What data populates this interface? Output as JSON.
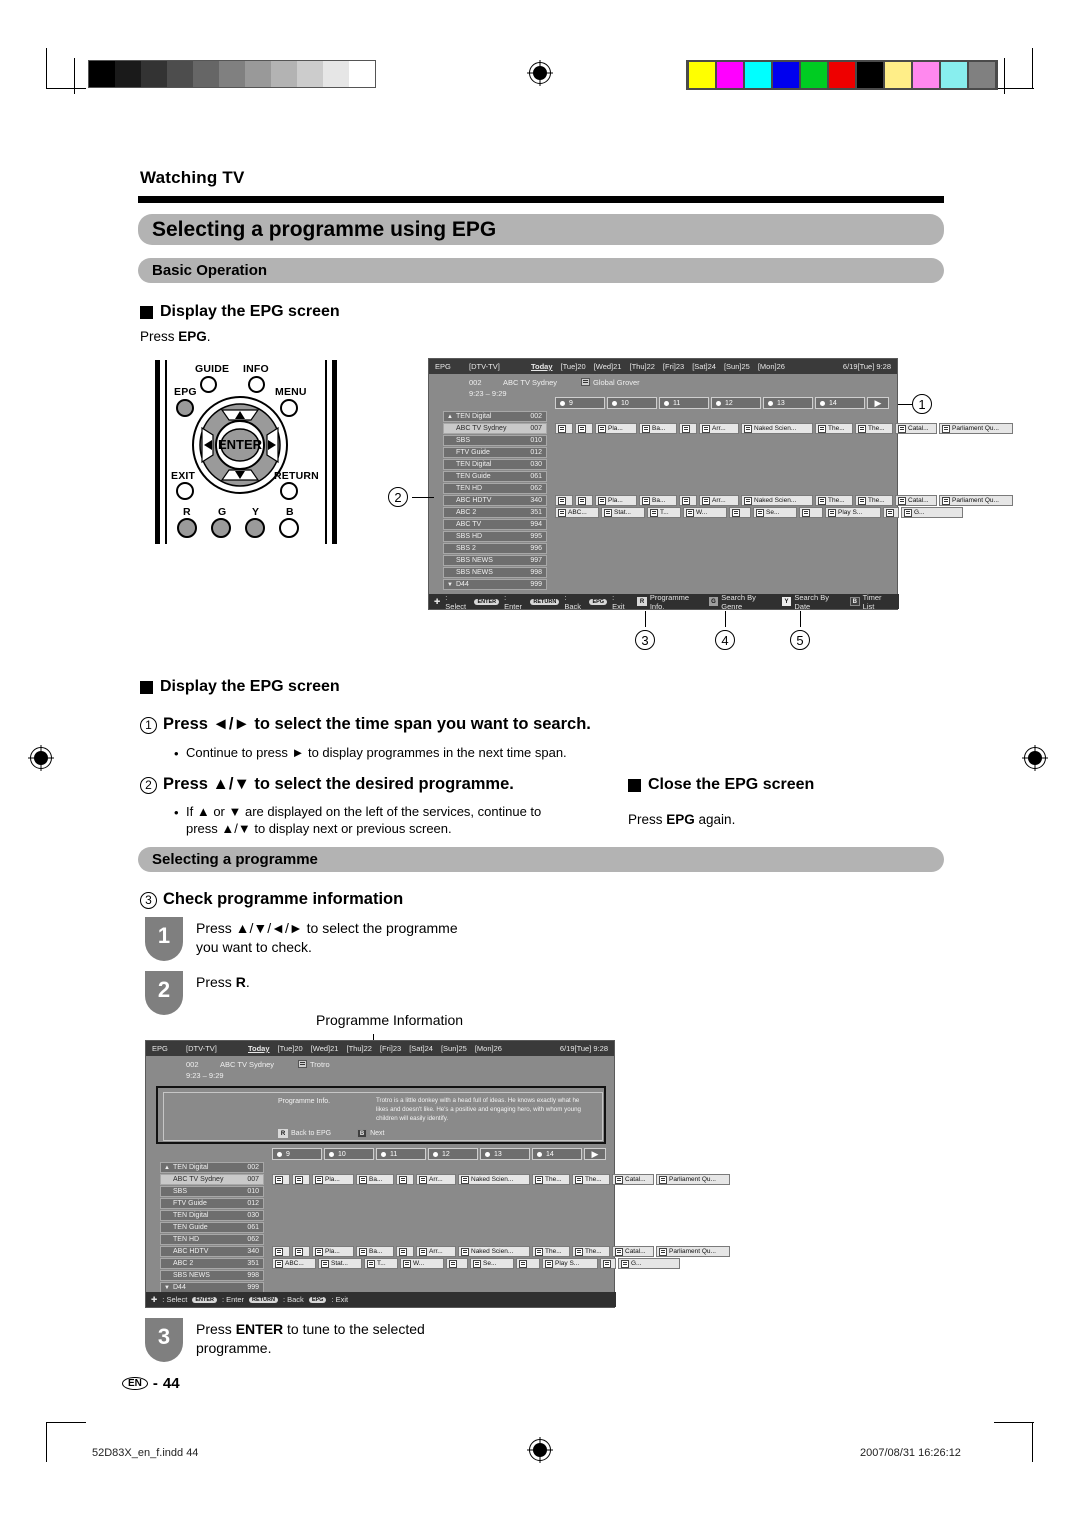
{
  "document": {
    "breadcrumb": "Watching TV",
    "title": "Selecting a programme using EPG",
    "section_basic": "Basic Operation",
    "section_selecting": "Selecting a programme",
    "page_label": "EN",
    "page_separator": "-",
    "page_number": "44"
  },
  "footer": {
    "file": "52D83X_en_f.indd  44",
    "timestamp": "2007/08/31   16:26:12"
  },
  "display_section": {
    "heading": "Display the EPG screen",
    "press_prefix": "Press ",
    "press_key": "EPG",
    "press_suffix": "."
  },
  "remote": {
    "labels": {
      "guide": "GUIDE",
      "info": "INFO",
      "epg": "EPG",
      "menu": "MENU",
      "enter": "ENTER",
      "exit": "EXIT",
      "return": "RETURN",
      "r": "R",
      "g": "G",
      "y": "Y",
      "b": "B"
    }
  },
  "callouts": {
    "one": "1",
    "two": "2",
    "three": "3",
    "four": "4",
    "five": "5"
  },
  "instructions": {
    "heading2": "Display the EPG screen",
    "step1": {
      "num": "1",
      "text": "Press ◄/► to select the time span you want to search.",
      "bullet": "Continue to press ► to display programmes in the next time span."
    },
    "step2": {
      "num": "2",
      "text": "Press ▲/▼ to select the desired programme.",
      "bullet_line1": "If ▲ or ▼ are displayed on the left of the services, continue to",
      "bullet_line2": "press ▲/▼ to display next or previous screen."
    },
    "close": {
      "heading": "Close the EPG screen",
      "text_prefix": "Press ",
      "text_key": "EPG",
      "text_suffix": " again."
    },
    "step3": {
      "num": "3",
      "heading": "Check programme information",
      "sub1": {
        "badge": "1",
        "line1": "Press ▲/▼/◄/► to select the programme",
        "line2": "you want to check."
      },
      "sub2": {
        "badge": "2",
        "text_prefix": "Press ",
        "text_key": "R",
        "text_suffix": "."
      },
      "sub3": {
        "badge": "3",
        "line1_prefix": "Press ",
        "line1_key": "ENTER",
        "line1_suffix": " to tune to the selected",
        "line2": "programme."
      }
    }
  },
  "caption": {
    "programme_information": "Programme Information"
  },
  "epg": {
    "header": {
      "app": "EPG",
      "source": "[DTV-TV]",
      "days": [
        "Today",
        "[Tue]20",
        "[Wed]21",
        "[Thu]22",
        "[Fri]23",
        "[Sat]24",
        "[Sun]25",
        "[Mon]26"
      ],
      "clock": "6/19[Tue]  9:28"
    },
    "now": {
      "channel_number": "002",
      "channel_name": "ABC TV Sydney",
      "programme_title": "Global Grover",
      "time_range": "9:23 – 9:29"
    },
    "timeslots": [
      "9",
      "10",
      "11",
      "12",
      "13",
      "14"
    ],
    "channels": [
      {
        "name": "TEN Digital",
        "number": "002",
        "arrow": "▲",
        "selected": false
      },
      {
        "name": "ABC TV Sydney",
        "number": "007",
        "arrow": "",
        "selected": true
      },
      {
        "name": "SBS",
        "number": "010",
        "arrow": "",
        "selected": false
      },
      {
        "name": "FTV Guide",
        "number": "012",
        "arrow": "",
        "selected": false
      },
      {
        "name": "TEN Digital",
        "number": "030",
        "arrow": "",
        "selected": false
      },
      {
        "name": "TEN Guide",
        "number": "061",
        "arrow": "",
        "selected": false
      },
      {
        "name": "TEN HD",
        "number": "062",
        "arrow": "",
        "selected": false
      },
      {
        "name": "ABC HDTV",
        "number": "340",
        "arrow": "",
        "selected": false
      },
      {
        "name": "ABC 2",
        "number": "351",
        "arrow": "",
        "selected": false
      },
      {
        "name": "ABC TV",
        "number": "994",
        "arrow": "",
        "selected": false
      },
      {
        "name": "SBS HD",
        "number": "995",
        "arrow": "",
        "selected": false
      },
      {
        "name": "SBS 2",
        "number": "996",
        "arrow": "",
        "selected": false
      },
      {
        "name": "SBS NEWS",
        "number": "997",
        "arrow": "",
        "selected": false
      },
      {
        "name": "SBS NEWS",
        "number": "998",
        "arrow": "",
        "selected": false
      },
      {
        "name": "D44",
        "number": "999",
        "arrow": "▼",
        "selected": false
      }
    ],
    "programme_row_a": [
      "Pla...",
      "Ba...",
      "Arr...",
      "Naked Scien...",
      "The...",
      "The...",
      "Catal...",
      "Parliament Qu..."
    ],
    "programme_row_b": [
      "ABC...",
      "Stat...",
      "T...",
      "W...",
      "Se...",
      "Play S...",
      "G..."
    ],
    "bar": {
      "select": ": Select",
      "enter_key": "ENTER",
      "enter": ": Enter",
      "return_key": "RETURN",
      "back": ": Back",
      "epg_key": "EPG",
      "exit": ": Exit",
      "buttons": [
        {
          "key": "R",
          "label": "Programme Info."
        },
        {
          "key": "G",
          "label": "Search By Genre"
        },
        {
          "key": "Y",
          "label": "Search By Date"
        },
        {
          "key": "B",
          "label": "Timer List"
        }
      ]
    }
  },
  "epg2": {
    "header": {
      "app": "EPG",
      "source": "[DTV-TV]",
      "days": [
        "Today",
        "[Tue]20",
        "[Wed]21",
        "[Thu]22",
        "[Fri]23",
        "[Sat]24",
        "[Sun]25",
        "[Mon]26"
      ],
      "clock": "6/19[Tue]  9:28"
    },
    "now": {
      "channel_number": "002",
      "channel_name": "ABC TV Sydney",
      "programme_title": "Trotro",
      "time_range": "9:23 – 9:29"
    },
    "info_panel": {
      "label": "Programme Info.",
      "text": "Trotro is a little donkey with a head full of ideas. He knows exactly what he likes and doesn't like. He's a positive and engaging hero, with whom young children will easily identify.",
      "key_back": "R",
      "label_back": "Back to EPG",
      "key_next": "B",
      "label_next": "Next"
    },
    "timeslots": [
      "9",
      "10",
      "11",
      "12",
      "13",
      "14"
    ],
    "channels": [
      {
        "name": "TEN Digital",
        "number": "002",
        "arrow": "▲",
        "selected": false
      },
      {
        "name": "ABC TV Sydney",
        "number": "007",
        "arrow": "",
        "selected": true
      },
      {
        "name": "SBS",
        "number": "010",
        "arrow": "",
        "selected": false
      },
      {
        "name": "FTV Guide",
        "number": "012",
        "arrow": "",
        "selected": false
      },
      {
        "name": "TEN Digital",
        "number": "030",
        "arrow": "",
        "selected": false
      },
      {
        "name": "TEN Guide",
        "number": "061",
        "arrow": "",
        "selected": false
      },
      {
        "name": "TEN HD",
        "number": "062",
        "arrow": "",
        "selected": false
      },
      {
        "name": "ABC HDTV",
        "number": "340",
        "arrow": "",
        "selected": false
      },
      {
        "name": "ABC 2",
        "number": "351",
        "arrow": "",
        "selected": false
      },
      {
        "name": "SBS NEWS",
        "number": "998",
        "arrow": "",
        "selected": false
      },
      {
        "name": "D44",
        "number": "999",
        "arrow": "▼",
        "selected": false
      }
    ],
    "programme_row_a": [
      "Pla...",
      "Ba...",
      "Arr...",
      "Naked Scien...",
      "The...",
      "The...",
      "Catal...",
      "Parliament Qu..."
    ],
    "programme_row_b": [
      "ABC...",
      "Stat...",
      "T...",
      "W...",
      "Se...",
      "Play S...",
      "G..."
    ],
    "bar": {
      "select": ": Select",
      "enter_key": "ENTER",
      "enter": ": Enter",
      "return_key": "RETURN",
      "back": ": Back",
      "epg_key": "EPG",
      "exit": ": Exit"
    }
  },
  "print_marks": {
    "grey_steps": [
      "#000000",
      "#1a1a1a",
      "#333333",
      "#4d4d4d",
      "#666666",
      "#808080",
      "#999999",
      "#b3b3b3",
      "#cccccc",
      "#e6e6e6",
      "#ffffff"
    ],
    "colors": [
      "#ffff00",
      "#ff00ff",
      "#00ffff",
      "#0000ee",
      "#00cc22",
      "#ee0000",
      "#000000",
      "#ffee88",
      "#ff88ee",
      "#88eeee",
      "#808080"
    ]
  }
}
